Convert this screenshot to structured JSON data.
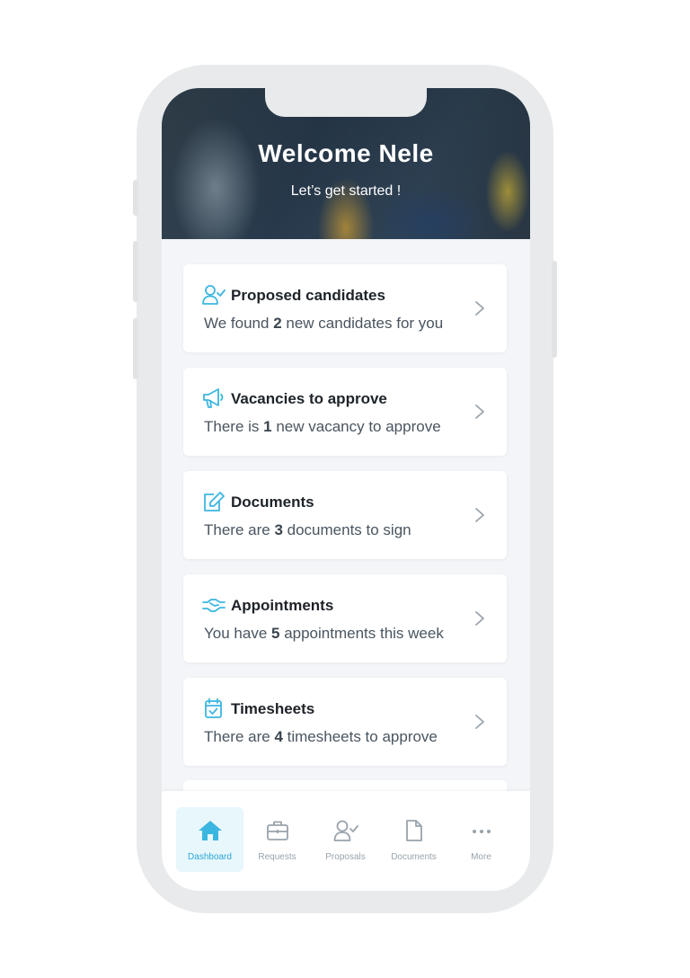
{
  "header": {
    "title": "Welcome Nele",
    "subtitle": "Let’s get started !"
  },
  "cards": [
    {
      "icon": "user-check-icon",
      "title": "Proposed candidates",
      "prefix": "We found ",
      "count": "2",
      "suffix": " new candidates for you"
    },
    {
      "icon": "megaphone-icon",
      "title": "Vacancies to approve",
      "prefix": "There is ",
      "count": "1",
      "suffix": " new vacancy to approve"
    },
    {
      "icon": "edit-document-icon",
      "title": "Documents",
      "prefix": "There are ",
      "count": "3",
      "suffix": " documents to sign"
    },
    {
      "icon": "handshake-icon",
      "title": "Appointments",
      "prefix": "You have ",
      "count": "5",
      "suffix": " appointments this week"
    },
    {
      "icon": "calendar-check-icon",
      "title": "Timesheets",
      "prefix": "There are ",
      "count": "4",
      "suffix": " timesheets to approve"
    }
  ],
  "tabbar": {
    "active": "Dashboard",
    "items": [
      {
        "label": "Dashboard",
        "icon": "home-icon"
      },
      {
        "label": "Requests",
        "icon": "briefcase-icon"
      },
      {
        "label": "Proposals",
        "icon": "user-check-icon"
      },
      {
        "label": "Documents",
        "icon": "file-icon"
      },
      {
        "label": "More",
        "icon": "more-dots-icon"
      }
    ]
  },
  "colors": {
    "accent": "#2aa7d8",
    "icon": "#3bb6e0",
    "background": "#f3f5f8",
    "title_text": "#1e2329",
    "body_text": "#4a5560"
  }
}
